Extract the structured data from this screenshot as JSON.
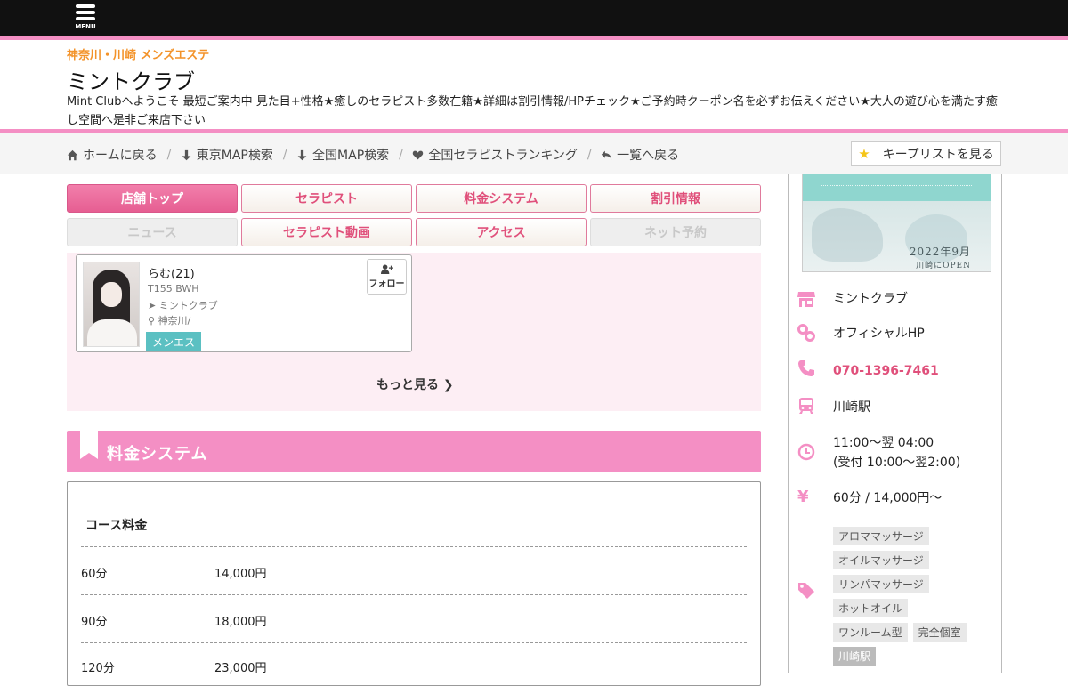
{
  "header": {
    "menu_label": "MENU",
    "area": "神奈川・川崎 メンズエステ",
    "title": "ミントクラブ",
    "description": "Mint Clubへようこそ 最短ご案内中 見た目+性格★癒しのセラピスト多数在籍★詳細は割引情報/HPチェック★ご予約時クーポン名を必ずお伝えください★大人の遊び心を満たす癒し空間へ是非ご来店下さい"
  },
  "breadcrumbs": [
    {
      "label": "ホームに戻る",
      "icon": "home-icon"
    },
    {
      "label": "東京MAP検索",
      "icon": "arrow-down-icon"
    },
    {
      "label": "全国MAP検索",
      "icon": "arrow-down-icon"
    },
    {
      "label": "全国セラピストランキング",
      "icon": "heart-icon"
    },
    {
      "label": "一覧へ戻る",
      "icon": "reply-icon"
    }
  ],
  "keep_list_label": "キープリストを見る",
  "tabs": [
    {
      "label": "店舗トップ",
      "state": "active"
    },
    {
      "label": "セラピスト",
      "state": "normal"
    },
    {
      "label": "料金システム",
      "state": "normal"
    },
    {
      "label": "割引情報",
      "state": "normal"
    },
    {
      "label": "ニュース",
      "state": "disabled"
    },
    {
      "label": "セラピスト動画",
      "state": "normal"
    },
    {
      "label": "アクセス",
      "state": "normal"
    },
    {
      "label": "ネット予約",
      "state": "disabled"
    }
  ],
  "therapist": {
    "name": "らむ(21)",
    "size": "T155 BWH",
    "shop": "ミントクラブ",
    "location": "神奈川/",
    "tag": "メンエス",
    "follow_label": "フォロー"
  },
  "more_label": "もっと見る",
  "pricing": {
    "section_title": "料金システム",
    "course_heading": "コース料金",
    "rows": [
      {
        "duration": "60分",
        "price": "14,000円"
      },
      {
        "duration": "90分",
        "price": "18,000円"
      },
      {
        "duration": "120分",
        "price": "23,000円"
      }
    ]
  },
  "sidebar": {
    "banner_year": "2022年9月",
    "banner_open": "川崎にOPEN",
    "shop_name": "ミントクラブ",
    "official_hp": "オフィシャルHP",
    "phone": "070-1396-7461",
    "station": "川崎駅",
    "hours_line1": "11:00～翌 04:00",
    "hours_line2": "(受付 10:00～翌2:00)",
    "price": "60分 / 14,000円～",
    "tags": [
      "アロママッサージ",
      "オイルマッサージ",
      "リンパマッサージ",
      "ホットオイル",
      "ワンルーム型",
      "完全個室",
      "川崎駅"
    ]
  },
  "colors": {
    "accent": "#f48fc4",
    "tab_text": "#e0507b",
    "area_text": "#f3932a",
    "tag_teal": "#5bc0c2"
  }
}
